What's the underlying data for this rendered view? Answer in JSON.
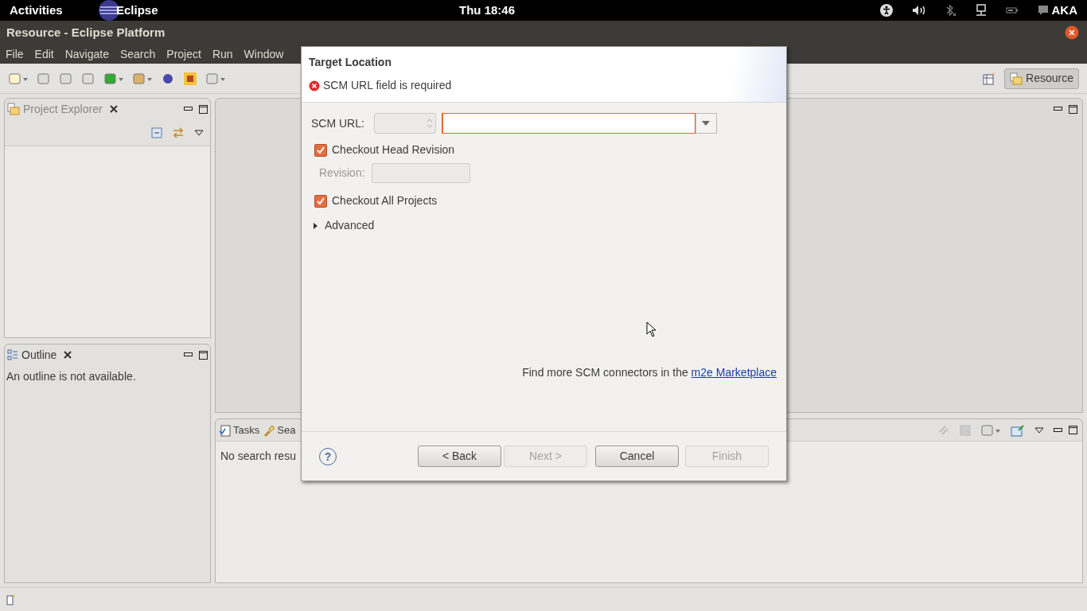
{
  "top_bar": {
    "activities": "Activities",
    "app": "Eclipse",
    "clock": "Thu 18:46",
    "user": "AKA"
  },
  "window": {
    "title": "Resource - Eclipse Platform"
  },
  "menu": [
    "File",
    "Edit",
    "Navigate",
    "Search",
    "Project",
    "Run",
    "Window"
  ],
  "perspective": {
    "label": "Resource",
    "selected": true
  },
  "views": {
    "project_explorer": {
      "title": "Project Explorer",
      "selected": false
    },
    "outline": {
      "title": "Outline",
      "selected": true,
      "message": "An outline is not available."
    },
    "bottom_tabs": [
      {
        "label": "Tasks"
      },
      {
        "label": "Sea"
      }
    ],
    "bottom_message": "No search resu"
  },
  "dialog": {
    "title": "Target Location",
    "error": "SCM URL field is required",
    "scm_label": "SCM URL:",
    "options": [
      {
        "label": "Checkout Head Revision",
        "checked": true
      },
      {
        "label": "Checkout All Projects",
        "checked": true
      }
    ],
    "revision": {
      "label": "Revision:",
      "disabled": true
    },
    "advanced": {
      "label": "Advanced",
      "expanded": false
    },
    "connectors_text": "Find more SCM connectors in the ",
    "connectors_link": "m2e Marketplace",
    "help": "?",
    "buttons": [
      {
        "label": "< Back",
        "disabled": false
      },
      {
        "label": "Next >",
        "disabled": true
      },
      {
        "label": "Cancel",
        "disabled": false
      },
      {
        "label": "Finish",
        "disabled": true
      }
    ]
  }
}
